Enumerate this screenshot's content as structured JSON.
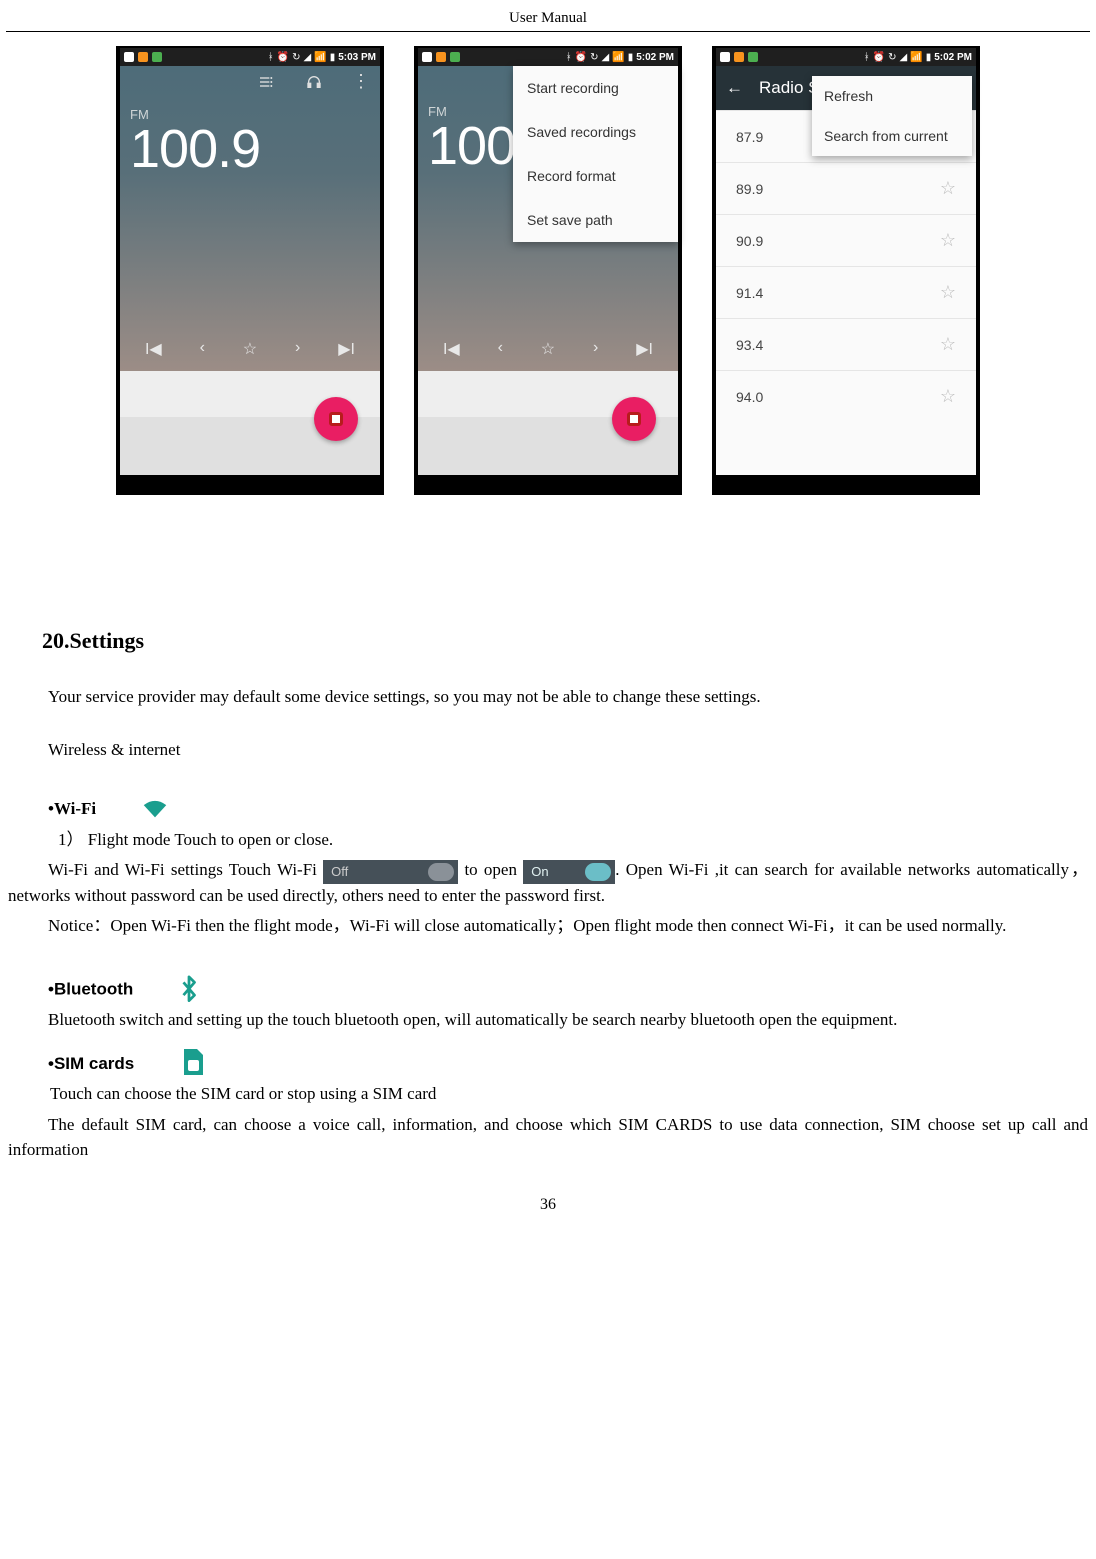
{
  "header": "User    Manual",
  "page_number": "36",
  "phone1": {
    "time": "5:03 PM",
    "fm_label": "FM",
    "frequency": "100.9"
  },
  "phone2": {
    "time": "5:02 PM",
    "fm_label": "FM",
    "frequency": "100.9",
    "menu": {
      "item1": "Start recording",
      "item2": "Saved recordings",
      "item3": "Record format",
      "item4": "Set save path"
    }
  },
  "phone3": {
    "time": "5:02 PM",
    "appbar_title": "Radio S",
    "menu": {
      "item1": "Refresh",
      "item2": "Search from current"
    },
    "stations": {
      "s0": "87.9",
      "s1": "89.9",
      "s2": "90.9",
      "s3": "91.4",
      "s4": "93.4",
      "s5": "94.0"
    }
  },
  "body": {
    "section_title": "20.Settings",
    "intro": "Your service provider may default some device settings, so you may not be able to change these settings.",
    "wireless_head": "Wireless & internet",
    "wifi_head": "•Wi-Fi",
    "flight_line": "1） Flight mode      Touch to open or close.",
    "wifi_line_a": "Wi-Fi and Wi-Fi settings       Touch Wi-Fi ",
    "toggle_off_label": "Off",
    "wifi_line_b": " to open ",
    "toggle_on_label": "On",
    "wifi_line_c": ". Open Wi-Fi ,it can search for available networks automatically，networks without password can be used directly, others need to enter the password first.",
    "notice": "Notice：Open Wi-Fi then the flight mode，Wi-Fi will close automatically；Open flight mode then connect Wi-Fi，it can be used normally.",
    "bt_head": "•Bluetooth",
    "bt_body": "Bluetooth switch and setting up the touch bluetooth open, will automatically be search nearby bluetooth open the equipment.",
    "sim_head": "•SIM cards",
    "sim_line1": "Touch can choose the SIM card or stop using a SIM card",
    "sim_line2": "The default SIM card, can choose a voice call, information, and choose which SIM CARDS to use data connection, SIM choose set up call and information"
  }
}
